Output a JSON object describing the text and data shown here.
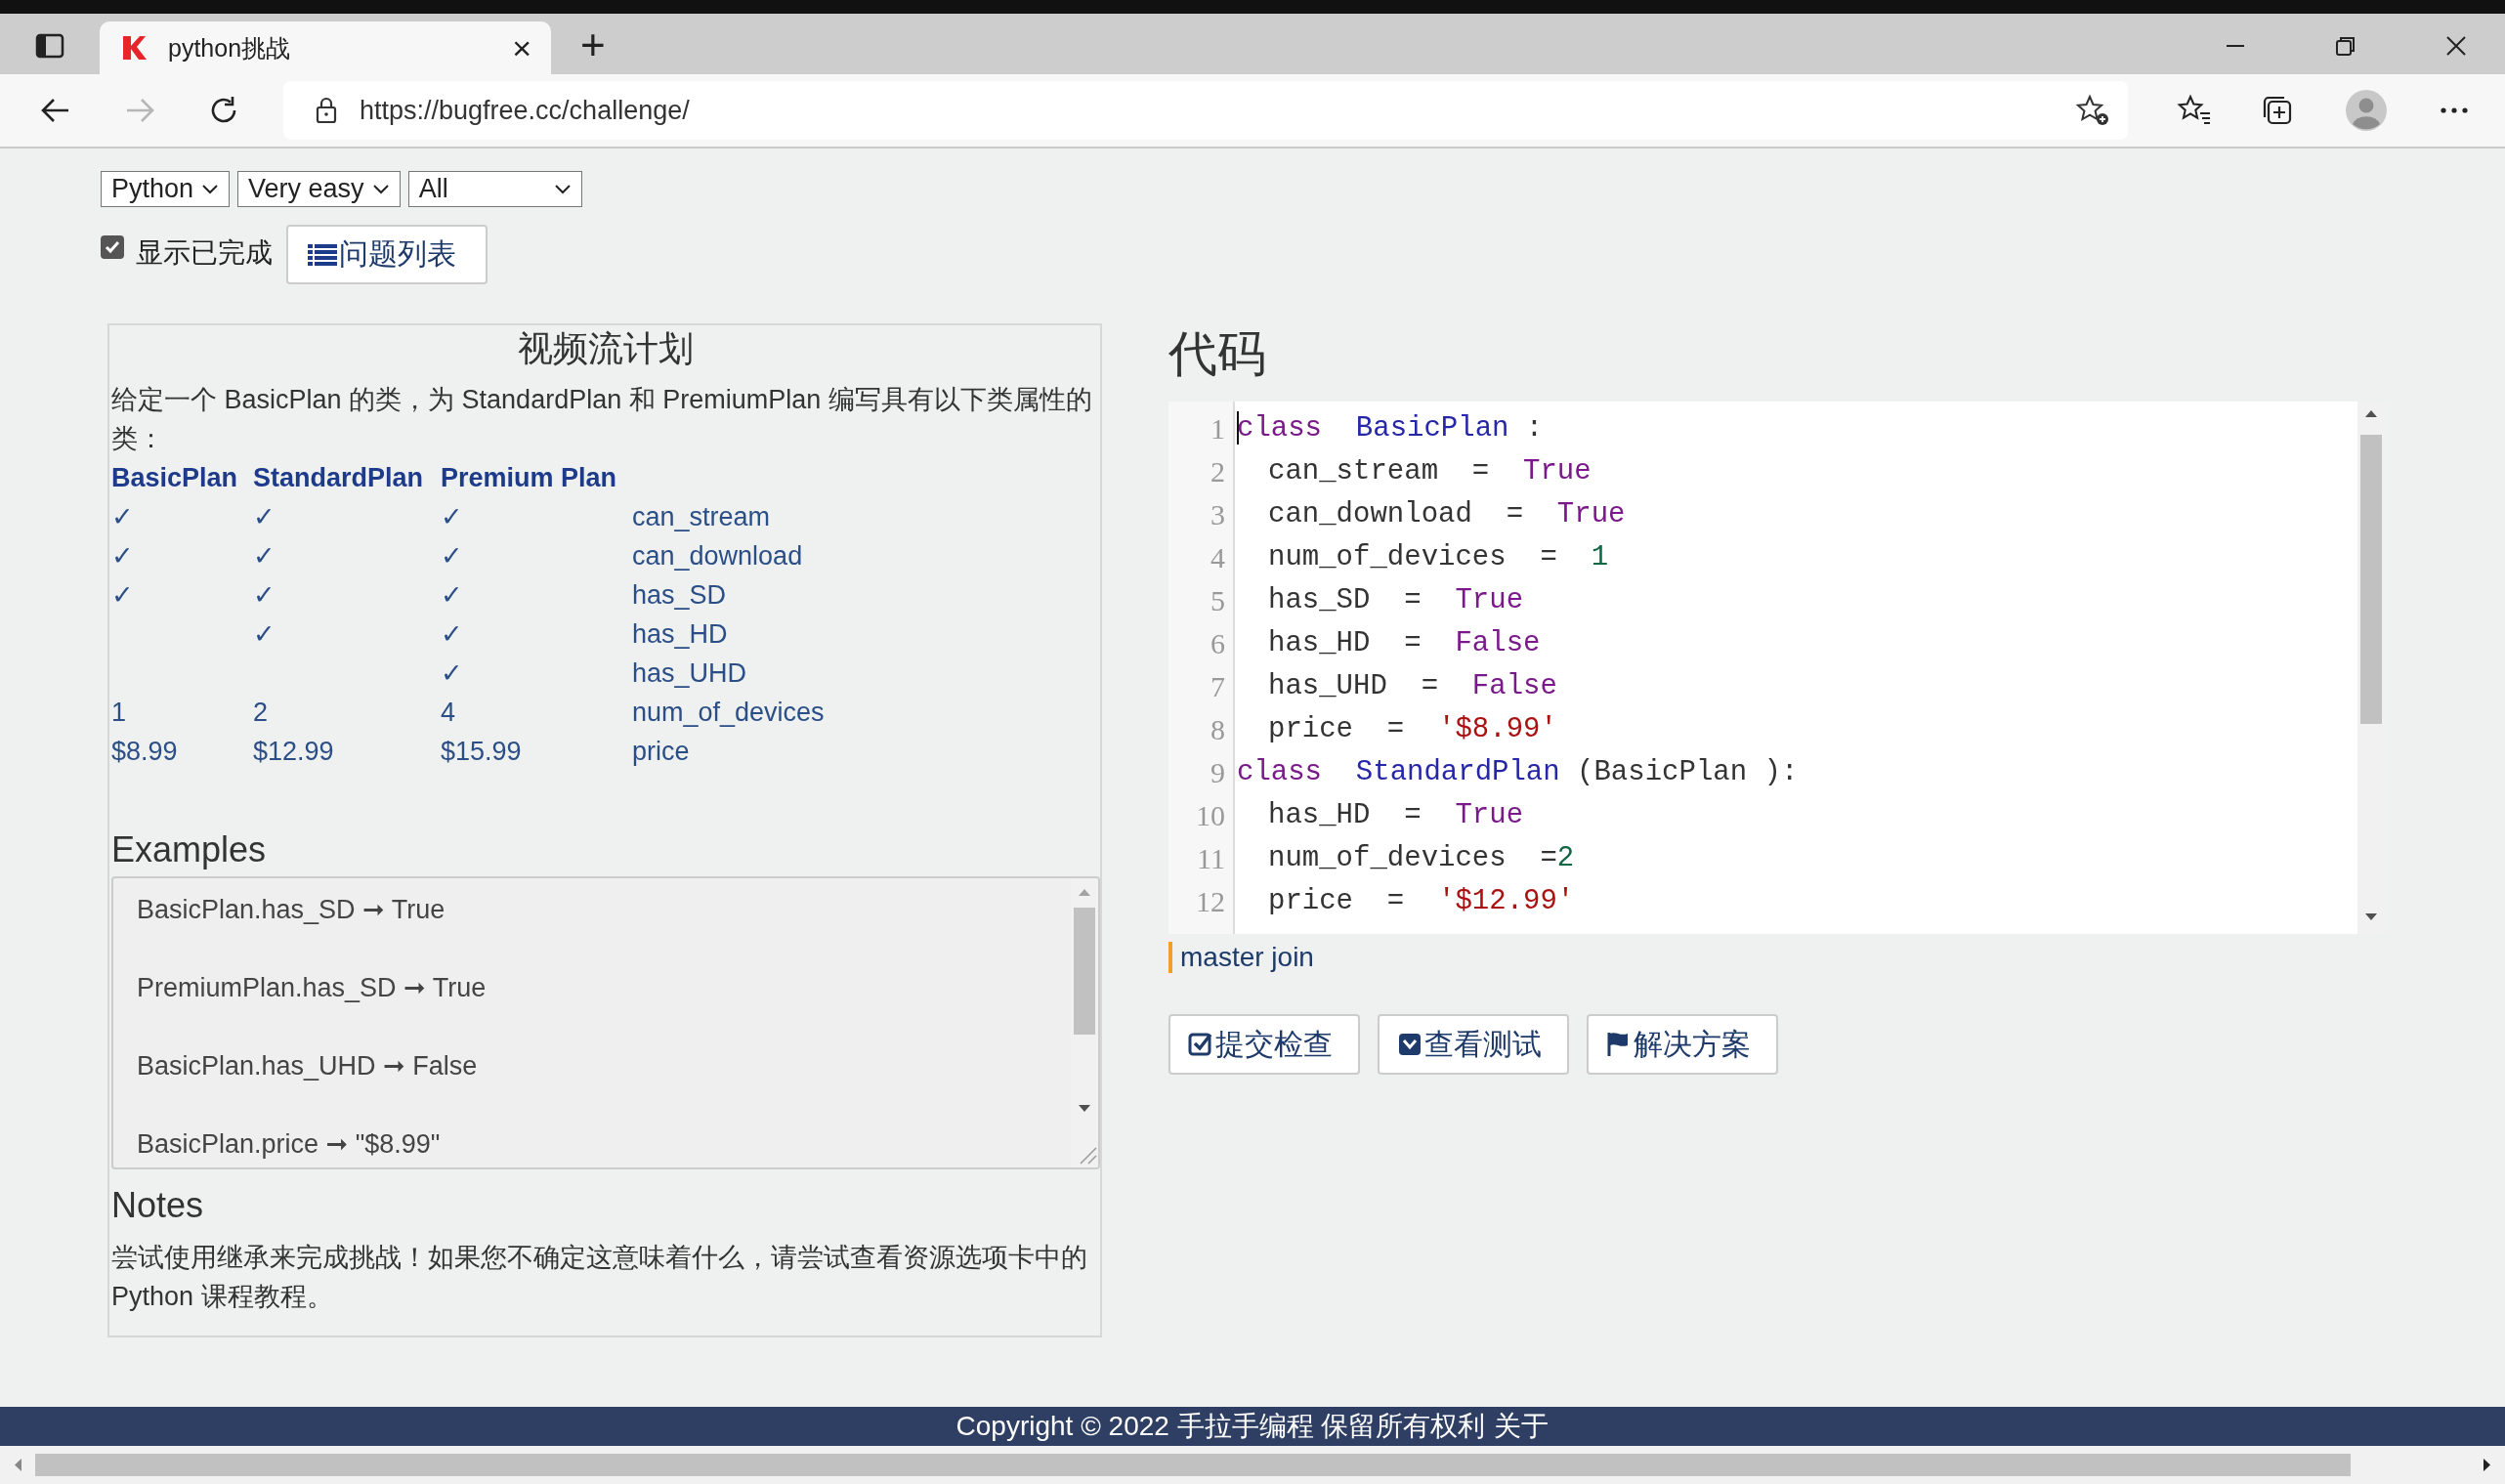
{
  "browser": {
    "tabs": [
      {
        "title": "python挑战",
        "close": "×",
        "selected": true
      }
    ],
    "new_tab": "+",
    "nav_buttons": [
      {
        "kind": "back",
        "disabled": false
      },
      {
        "kind": "forward",
        "disabled": true
      },
      {
        "kind": "refresh",
        "disabled": false
      }
    ],
    "address": "https://bugfree.cc/challenge/"
  },
  "filters": [
    {
      "value": "Python"
    },
    {
      "value": "Very easy"
    },
    {
      "value": "All"
    }
  ],
  "show_completed": {
    "label": "显示已完成",
    "checked": true
  },
  "problem_list_button": "问题列表",
  "problem": {
    "title": "视频流计划",
    "description": "给定一个 BasicPlan 的类，为 StandardPlan 和 PremiumPlan 编写具有以下类属性的类：",
    "table": {
      "columns": [
        "BasicPlan",
        "StandardPlan",
        "Premium Plan"
      ],
      "rows": [
        {
          "basic": "✓",
          "standard": "✓",
          "premium": "✓",
          "attribute": "can_stream"
        },
        {
          "basic": "✓",
          "standard": "✓",
          "premium": "✓",
          "attribute": "can_download"
        },
        {
          "basic": "✓",
          "standard": "✓",
          "premium": "✓",
          "attribute": "has_SD"
        },
        {
          "standard": "✓",
          "premium": "✓",
          "attribute": "has_HD"
        },
        {
          "premium": "✓",
          "attribute": "has_UHD"
        },
        {
          "basic": "1",
          "standard": "2",
          "premium": "4",
          "attribute": "num_of_devices"
        },
        {
          "basic": "$8.99",
          "standard": "$12.99",
          "premium": "$15.99",
          "attribute": "price"
        }
      ]
    },
    "examples_heading": "Examples",
    "examples": [
      "BasicPlan.has_SD ➞ True",
      "PremiumPlan.has_SD ➞ True",
      "BasicPlan.has_UHD ➞ False",
      "BasicPlan.price ➞ \"$8.99\""
    ],
    "notes_heading": "Notes",
    "notes": "尝试使用继承来完成挑战！如果您不确定这意味着什么，请尝试查看资源选项卡中的 Python 课程教程。"
  },
  "code": {
    "heading": "代码",
    "lines": [
      {
        "number": "1",
        "tokens": [
          {
            "kind": "keyword",
            "text": "class"
          },
          {
            "kind": "class",
            "text": "  BasicPlan"
          },
          {
            "kind": "op",
            "text": " :"
          }
        ],
        "children": [
          {
            "number": "2",
            "tokens": [
              {
                "kind": "name",
                "text": "can_stream"
              },
              {
                "kind": "op",
                "text": "  =  "
              },
              {
                "kind": "bool",
                "text": "True"
              }
            ]
          },
          {
            "number": "3",
            "tokens": [
              {
                "kind": "name",
                "text": "can_download"
              },
              {
                "kind": "op",
                "text": "  =  "
              },
              {
                "kind": "bool",
                "text": "True"
              }
            ]
          },
          {
            "number": "4",
            "tokens": [
              {
                "kind": "name",
                "text": "num_of_devices"
              },
              {
                "kind": "op",
                "text": "  =  "
              },
              {
                "kind": "number",
                "text": "1"
              }
            ]
          },
          {
            "number": "5",
            "tokens": [
              {
                "kind": "name",
                "text": "has_SD"
              },
              {
                "kind": "op",
                "text": "  =  "
              },
              {
                "kind": "bool",
                "text": "True"
              }
            ]
          },
          {
            "number": "6",
            "tokens": [
              {
                "kind": "name",
                "text": "has_HD"
              },
              {
                "kind": "op",
                "text": "  =  "
              },
              {
                "kind": "bool",
                "text": "False"
              }
            ]
          },
          {
            "number": "7",
            "tokens": [
              {
                "kind": "name",
                "text": "has_UHD"
              },
              {
                "kind": "op",
                "text": "  =  "
              },
              {
                "kind": "bool",
                "text": "False"
              }
            ]
          },
          {
            "number": "8",
            "tokens": [
              {
                "kind": "name",
                "text": "price"
              },
              {
                "kind": "op",
                "text": "  =  "
              },
              {
                "kind": "string",
                "text": "'$8.99'"
              }
            ]
          }
        ]
      },
      {
        "number": "9",
        "tokens": [
          {
            "kind": "keyword",
            "text": "class"
          },
          {
            "kind": "class",
            "text": "  StandardPlan"
          },
          {
            "kind": "op",
            "text": " (BasicPlan ):"
          }
        ],
        "children": [
          {
            "number": "10",
            "tokens": [
              {
                "kind": "name",
                "text": "has_HD"
              },
              {
                "kind": "op",
                "text": "  =  "
              },
              {
                "kind": "bool",
                "text": "True"
              }
            ]
          },
          {
            "number": "11",
            "tokens": [
              {
                "kind": "name",
                "text": "num_of_devices"
              },
              {
                "kind": "op",
                "text": "  ="
              },
              {
                "kind": "number",
                "text": "2"
              }
            ]
          },
          {
            "number": "12",
            "tokens": [
              {
                "kind": "name",
                "text": "price"
              },
              {
                "kind": "op",
                "text": "  =  "
              },
              {
                "kind": "string",
                "text": "'$12.99'"
              }
            ]
          }
        ]
      }
    ],
    "branch": "master join",
    "buttons": [
      {
        "kind": "submit",
        "label": "提交检查"
      },
      {
        "kind": "tests",
        "label": "查看测试"
      },
      {
        "kind": "solution",
        "label": "解决方案"
      }
    ]
  },
  "footer": {
    "text": "Copyright © 2022 手拉手编程 保留所有权利",
    "link": "关于"
  }
}
